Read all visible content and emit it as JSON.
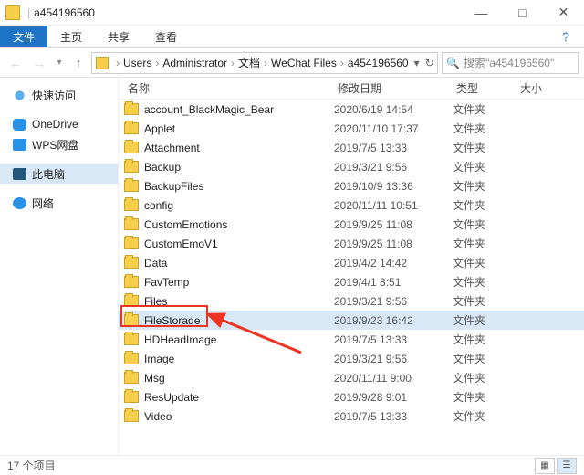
{
  "title": {
    "folder_icon": "folder",
    "separator": "|",
    "text": "a454196560"
  },
  "window_buttons": {
    "min": "—",
    "max": "□",
    "close": "✕"
  },
  "ribbon": {
    "file": "文件",
    "home": "主页",
    "share": "共享",
    "view": "查看",
    "help": "?"
  },
  "nav": {
    "back": "←",
    "forward": "→",
    "dropdown": "▾",
    "up": "↑"
  },
  "address": {
    "segs": [
      "Users",
      "Administrator",
      "文档",
      "WeChat Files",
      "a454196560"
    ],
    "gt": "›",
    "refresh": "↻",
    "dropdown": "▾"
  },
  "search": {
    "icon": "🔍",
    "placeholder": "搜索\"a454196560\""
  },
  "sidebar": {
    "items": [
      {
        "icon": "star",
        "label": "快速访问"
      },
      {
        "icon": "cloud",
        "label": "OneDrive"
      },
      {
        "icon": "wps",
        "label": "WPS网盘"
      },
      {
        "icon": "pc",
        "label": "此电脑",
        "selected": true
      },
      {
        "icon": "net",
        "label": "网络"
      }
    ]
  },
  "columns": {
    "name": "名称",
    "date": "修改日期",
    "type": "类型",
    "size": "大小"
  },
  "files": [
    {
      "name": "account_BlackMagic_Bear",
      "date": "2020/6/19 14:54",
      "type": "文件夹"
    },
    {
      "name": "Applet",
      "date": "2020/11/10 17:37",
      "type": "文件夹"
    },
    {
      "name": "Attachment",
      "date": "2019/7/5 13:33",
      "type": "文件夹"
    },
    {
      "name": "Backup",
      "date": "2019/3/21 9:56",
      "type": "文件夹"
    },
    {
      "name": "BackupFiles",
      "date": "2019/10/9 13:36",
      "type": "文件夹"
    },
    {
      "name": "config",
      "date": "2020/11/11 10:51",
      "type": "文件夹"
    },
    {
      "name": "CustomEmotions",
      "date": "2019/9/25 11:08",
      "type": "文件夹"
    },
    {
      "name": "CustomEmoV1",
      "date": "2019/9/25 11:08",
      "type": "文件夹"
    },
    {
      "name": "Data",
      "date": "2019/4/2 14:42",
      "type": "文件夹"
    },
    {
      "name": "FavTemp",
      "date": "2019/4/1 8:51",
      "type": "文件夹"
    },
    {
      "name": "Files",
      "date": "2019/3/21 9:56",
      "type": "文件夹"
    },
    {
      "name": "FileStorage",
      "date": "2019/9/23 16:42",
      "type": "文件夹",
      "selected": true,
      "highlight": true
    },
    {
      "name": "HDHeadImage",
      "date": "2019/7/5 13:33",
      "type": "文件夹"
    },
    {
      "name": "Image",
      "date": "2019/3/21 9:56",
      "type": "文件夹"
    },
    {
      "name": "Msg",
      "date": "2020/11/11 9:00",
      "type": "文件夹"
    },
    {
      "name": "ResUpdate",
      "date": "2019/9/28 9:01",
      "type": "文件夹"
    },
    {
      "name": "Video",
      "date": "2019/7/5 13:33",
      "type": "文件夹"
    }
  ],
  "status": {
    "count": "17 个项目",
    "view_large": "▦",
    "view_details": "☰"
  }
}
